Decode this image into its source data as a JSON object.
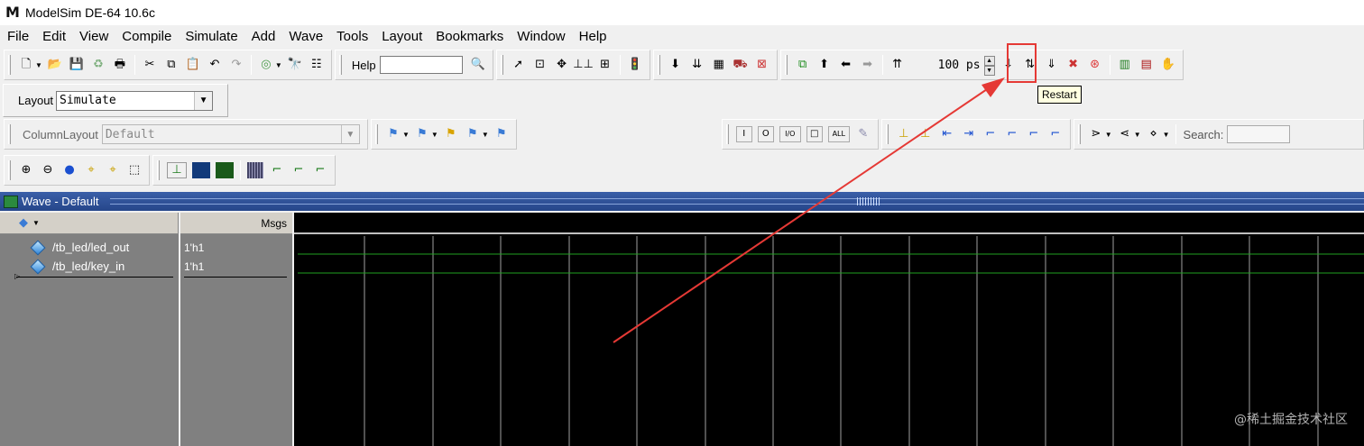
{
  "window": {
    "title": "ModelSim DE-64 10.6c",
    "logo_letter": "M"
  },
  "menubar": [
    {
      "label": "File"
    },
    {
      "label": "Edit"
    },
    {
      "label": "View"
    },
    {
      "label": "Compile"
    },
    {
      "label": "Simulate"
    },
    {
      "label": "Add"
    },
    {
      "label": "Wave"
    },
    {
      "label": "Tools"
    },
    {
      "label": "Layout"
    },
    {
      "label": "Bookmarks"
    },
    {
      "label": "Window"
    },
    {
      "label": "Help"
    }
  ],
  "toolbar": {
    "help_label": "Help",
    "help_value": "",
    "run_length": "100 ps",
    "restart_tooltip": "Restart"
  },
  "layout": {
    "label": "Layout",
    "value": "Simulate"
  },
  "column_layout": {
    "label": "ColumnLayout",
    "value": "Default"
  },
  "search": {
    "label": "Search:"
  },
  "wave_window": {
    "title": "Wave - Default",
    "msgs_header": "Msgs",
    "signals": [
      {
        "name": "/tb_led/led_out",
        "value": "1'h1"
      },
      {
        "name": "/tb_led/key_in",
        "value": "1'h1"
      }
    ]
  },
  "watermark": "@稀土掘金技术社区",
  "colors": {
    "signal_trace": "#1fa01f",
    "annotation": "#e53935",
    "grid_line": "#a0a0a0",
    "wave_background": "#000000"
  }
}
